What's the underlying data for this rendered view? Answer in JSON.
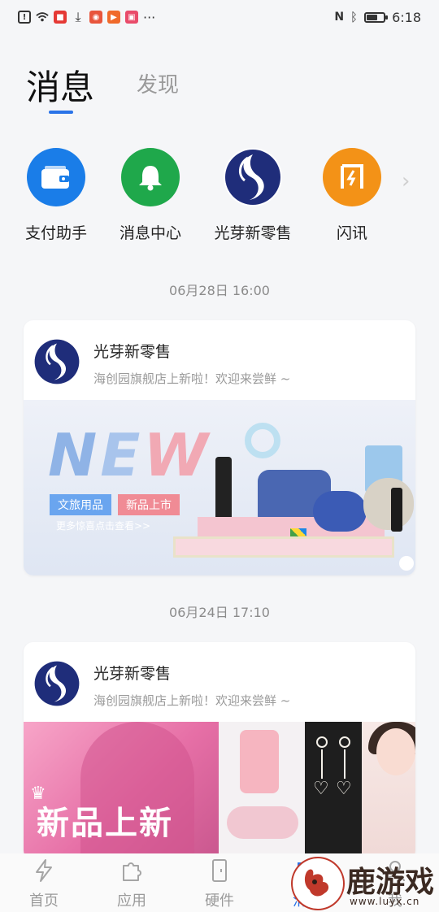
{
  "status_bar": {
    "time": "6:18",
    "left_icons": [
      "alert-icon",
      "wifi-icon",
      "video-icon",
      "download-icon",
      "app-icon",
      "play-icon",
      "app-icon",
      "more-icon"
    ],
    "right_icons": [
      "nfc-icon",
      "bluetooth-icon",
      "battery-icon"
    ],
    "battery_level": 0.6
  },
  "tabs": {
    "active": "消息",
    "inactive": "发现",
    "accent": "#2a73e8"
  },
  "quick_apps": [
    {
      "label": "支付助手",
      "icon": "wallet-icon",
      "color": "#1a7de8"
    },
    {
      "label": "消息中心",
      "icon": "bell-icon",
      "color": "#1fa84b"
    },
    {
      "label": "光芽新零售",
      "icon": "brand-logo",
      "color": "#1f2d7a"
    },
    {
      "label": "闪讯",
      "icon": "flash-news-icon",
      "color": "#f39217"
    }
  ],
  "messages": [
    {
      "timestamp": "06月28日 16:00",
      "sender": "光芽新零售",
      "text": "海创园旗舰店上新啦！欢迎来尝鲜 ~",
      "banner": {
        "headline": "NEW",
        "tag1": "文旅用品",
        "tag2": "新品上市",
        "link": "更多惊喜点击查看>>"
      }
    },
    {
      "timestamp": "06月24日 17:10",
      "sender": "光芽新零售",
      "text": "海创园旗舰店上新啦！欢迎来尝鲜 ~",
      "banner": {
        "headline": "新品上新"
      }
    }
  ],
  "bottom_nav": [
    {
      "label": "首页",
      "icon": "lightning-icon"
    },
    {
      "label": "应用",
      "icon": "puzzle-icon"
    },
    {
      "label": "硬件",
      "icon": "door-icon"
    },
    {
      "label": "消息",
      "icon": "message-icon",
      "active": true
    },
    {
      "label": "我",
      "icon": "user-icon"
    }
  ],
  "watermark": {
    "text": "鹿游戏",
    "url": "www.luyx.cn"
  }
}
